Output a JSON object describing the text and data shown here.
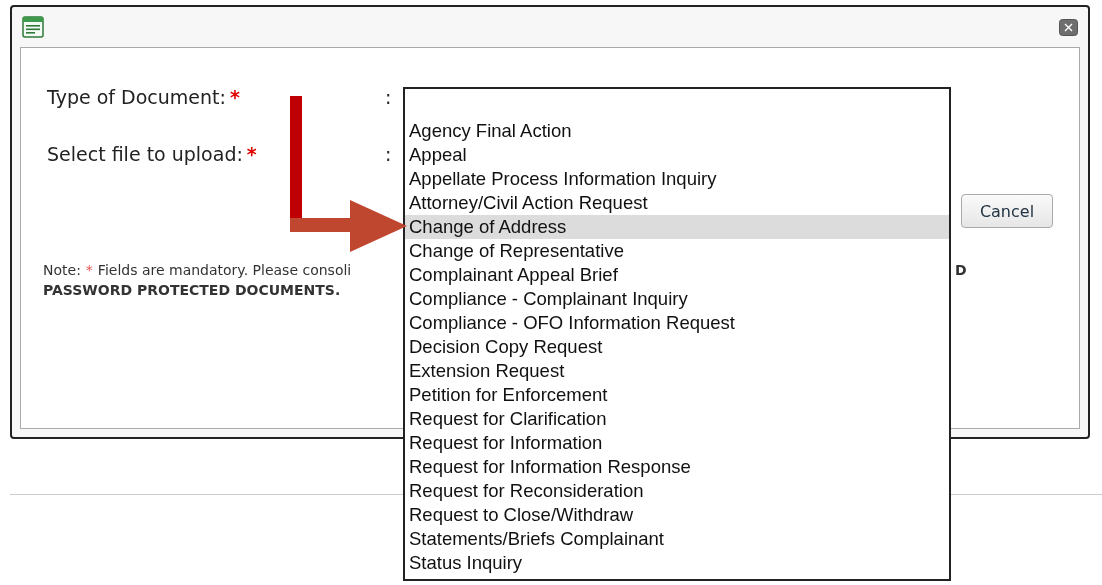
{
  "dialog": {
    "fields": [
      {
        "label": "Type of Document:",
        "required_mark": "*",
        "separator": ":"
      },
      {
        "label": "Select file to upload:",
        "required_mark": "*",
        "separator": ":"
      }
    ],
    "cancel_button": "Cancel",
    "note": {
      "prefix": "Note:",
      "mark": "*",
      "text": "Fields are mandatory. Please consoli",
      "tail": "D",
      "line_2": "PASSWORD PROTECTED DOCUMENTS."
    }
  },
  "dropdown": {
    "options": [
      {
        "label": "Agency Final Action",
        "selected": false
      },
      {
        "label": "Appeal",
        "selected": false
      },
      {
        "label": "Appellate Process Information Inquiry",
        "selected": false
      },
      {
        "label": "Attorney/Civil Action Request",
        "selected": false
      },
      {
        "label": "Change of Address",
        "selected": true
      },
      {
        "label": "Change of Representative",
        "selected": false
      },
      {
        "label": "Complainant Appeal Brief",
        "selected": false
      },
      {
        "label": "Compliance - Complainant Inquiry",
        "selected": false
      },
      {
        "label": "Compliance - OFO Information Request",
        "selected": false
      },
      {
        "label": "Decision Copy Request",
        "selected": false
      },
      {
        "label": "Extension Request",
        "selected": false
      },
      {
        "label": "Petition for Enforcement",
        "selected": false
      },
      {
        "label": "Request for Clarification",
        "selected": false
      },
      {
        "label": "Request for Information",
        "selected": false
      },
      {
        "label": "Request for Information Response",
        "selected": false
      },
      {
        "label": "Request for Reconsideration",
        "selected": false
      },
      {
        "label": "Request to Close/Withdraw",
        "selected": false
      },
      {
        "label": "Statements/Briefs Complainant",
        "selected": false
      },
      {
        "label": "Status Inquiry",
        "selected": false
      }
    ]
  }
}
